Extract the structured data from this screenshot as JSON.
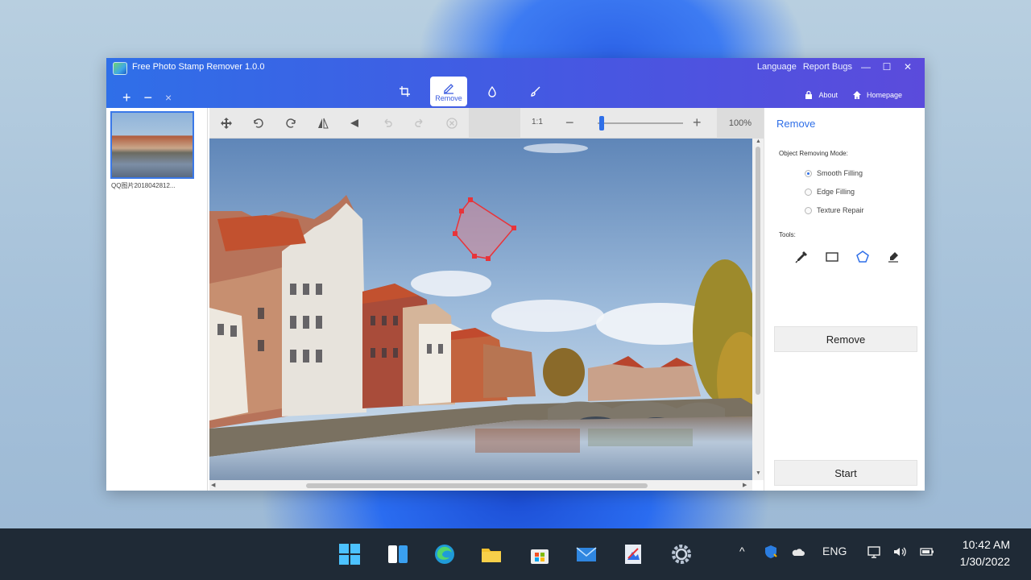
{
  "window": {
    "title": "Free Photo Stamp Remover 1.0.0",
    "language": "Language",
    "report_bugs": "Report Bugs",
    "about": "About",
    "homepage": "Homepage"
  },
  "list_controls": {
    "add": "+",
    "minus": "−",
    "close": "×"
  },
  "mode_tabs": [
    {
      "name": "crop",
      "label": ""
    },
    {
      "name": "remove",
      "label": "Remove"
    },
    {
      "name": "watermark",
      "label": ""
    },
    {
      "name": "brush",
      "label": ""
    }
  ],
  "thumbnail": {
    "label": "QQ图片2018042812..."
  },
  "toolbar": {
    "ratio": "1:1",
    "zoom_minus": "−",
    "zoom_plus": "+",
    "zoom_value": "100%",
    "zoom_level": 0.05
  },
  "right_panel": {
    "title": "Remove",
    "mode_label": "Object Removing Mode:",
    "modes": [
      "Smooth Filling",
      "Edge Filling",
      "Texture Repair"
    ],
    "selected_mode": "Smooth Filling",
    "tools_label": "Tools:",
    "tools": [
      "dropper-icon",
      "rectangle-icon",
      "polygon-icon",
      "brush-eraser-icon"
    ],
    "remove_button": "Remove",
    "start_button": "Start"
  },
  "taskbar": {
    "lang": "ENG",
    "time": "10:42 AM",
    "date": "1/30/2022"
  },
  "colors": {
    "accent": "#2f6fe8",
    "selection": "#e8343a"
  }
}
